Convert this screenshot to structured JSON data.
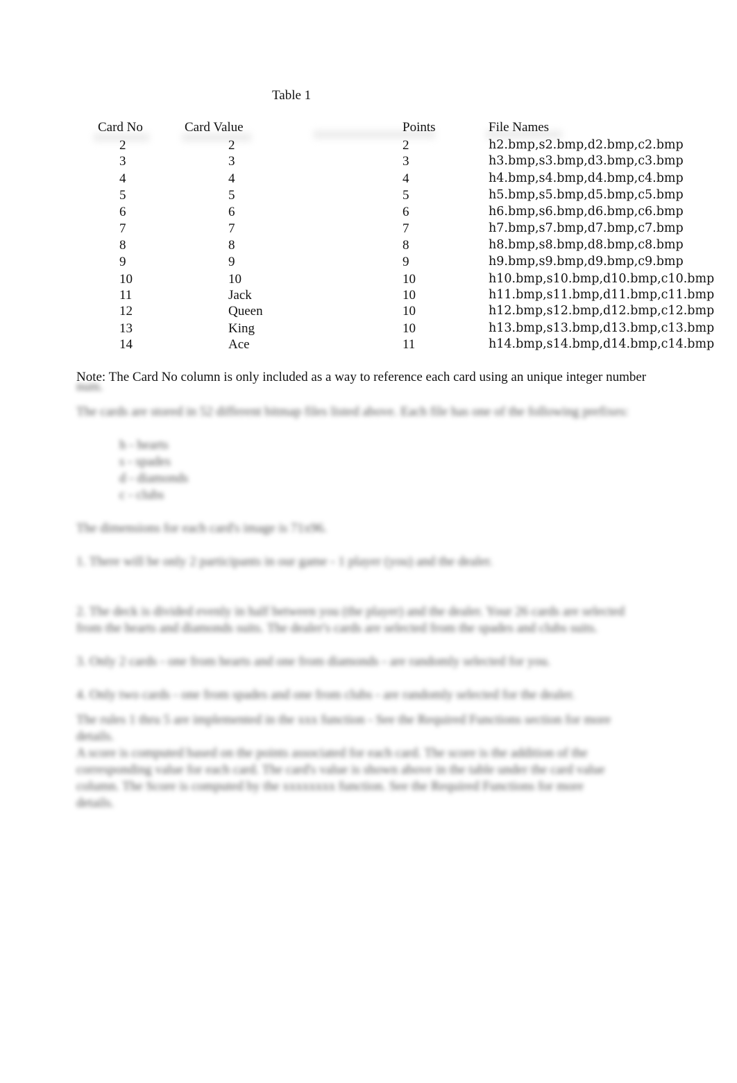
{
  "document": {
    "table_caption": "Table 1",
    "columns": [
      "Card No",
      "Card Value",
      "Points",
      "File Names"
    ],
    "rows": [
      {
        "card_no": "2",
        "card_value": "2",
        "points": "2",
        "files": "h2.bmp,s2.bmp,d2.bmp,c2.bmp"
      },
      {
        "card_no": "3",
        "card_value": "3",
        "points": "3",
        "files": "h3.bmp,s3.bmp,d3.bmp,c3.bmp"
      },
      {
        "card_no": "4",
        "card_value": "4",
        "points": "4",
        "files": "h4.bmp,s4.bmp,d4.bmp,c4.bmp"
      },
      {
        "card_no": "5",
        "card_value": "5",
        "points": "5",
        "files": "h5.bmp,s5.bmp,d5.bmp,c5.bmp"
      },
      {
        "card_no": "6",
        "card_value": "6",
        "points": "6",
        "files": "h6.bmp,s6.bmp,d6.bmp,c6.bmp"
      },
      {
        "card_no": "7",
        "card_value": "7",
        "points": "7",
        "files": "h7.bmp,s7.bmp,d7.bmp,c7.bmp"
      },
      {
        "card_no": "8",
        "card_value": "8",
        "points": "8",
        "files": "h8.bmp,s8.bmp,d8.bmp,c8.bmp"
      },
      {
        "card_no": "9",
        "card_value": "9",
        "points": "9",
        "files": "h9.bmp,s9.bmp,d9.bmp,c9.bmp"
      },
      {
        "card_no": "10",
        "card_value": "10",
        "points": "10",
        "files": "h10.bmp,s10.bmp,d10.bmp,c10.bmp"
      },
      {
        "card_no": "11",
        "card_value": "Jack",
        "points": "10",
        "files": "h11.bmp,s11.bmp,d11.bmp,c11.bmp"
      },
      {
        "card_no": "12",
        "card_value": "Queen",
        "points": "10",
        "files": "h12.bmp,s12.bmp,d12.bmp,c12.bmp"
      },
      {
        "card_no": "13",
        "card_value": "King",
        "points": "10",
        "files": "h13.bmp,s13.bmp,d13.bmp,c13.bmp"
      },
      {
        "card_no": "14",
        "card_value": "Ace",
        "points": "11",
        "files": "h14.bmp,s14.bmp,d14.bmp,c14.bmp"
      }
    ],
    "note": "Note: The Card No  column is only included as a way to reference each card using an unique integer number",
    "blurred_placeholder": "[obscured text]"
  }
}
